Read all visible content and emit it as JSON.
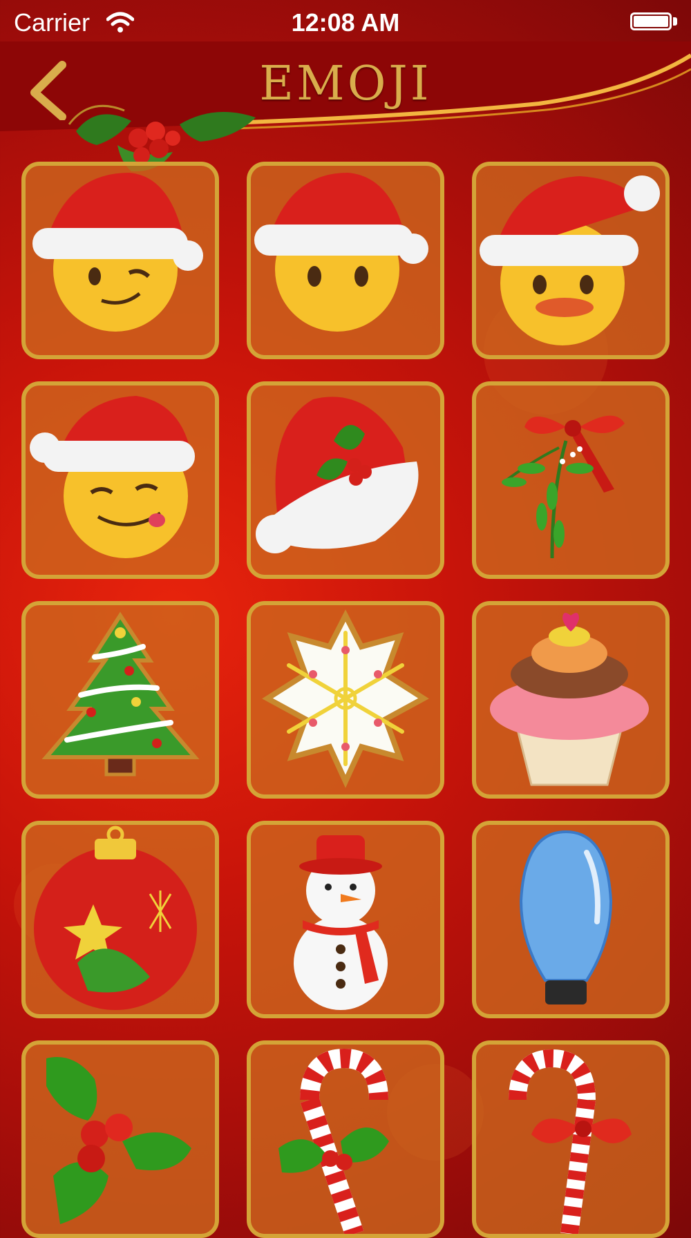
{
  "status_bar": {
    "carrier": "Carrier",
    "time": "12:08 AM"
  },
  "header": {
    "title": "EMOJI",
    "back_icon": "chevron-left-icon"
  },
  "colors": {
    "background": "#c8140a",
    "accent_gold": "#d4a437",
    "tile_fill": "#cd691e"
  },
  "emoji_tiles": [
    {
      "icon": "santa-winking-face-icon"
    },
    {
      "icon": "santa-neutral-face-icon"
    },
    {
      "icon": "santa-duck-face-icon"
    },
    {
      "icon": "santa-tongue-face-icon"
    },
    {
      "icon": "santa-hat-holly-icon"
    },
    {
      "icon": "mistletoe-bow-icon"
    },
    {
      "icon": "christmas-tree-cookie-icon"
    },
    {
      "icon": "snowflake-cookie-icon"
    },
    {
      "icon": "cupcake-icon"
    },
    {
      "icon": "christmas-ornament-icon"
    },
    {
      "icon": "snowman-icon"
    },
    {
      "icon": "blue-light-bulb-icon"
    },
    {
      "icon": "holly-berries-icon"
    },
    {
      "icon": "candy-cane-holly-icon"
    },
    {
      "icon": "candy-cane-bow-icon"
    }
  ]
}
